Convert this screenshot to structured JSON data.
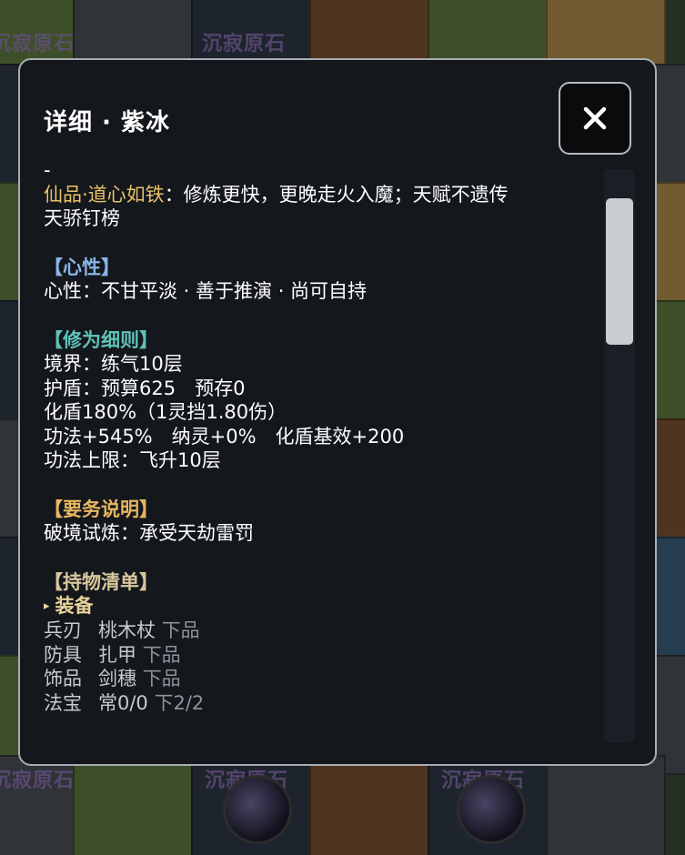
{
  "background": {
    "shrine_label": "沉寂原石"
  },
  "dialog": {
    "title": "详细 · 紫冰",
    "close_icon": "close-icon"
  },
  "content": {
    "dash": "-",
    "trait_name": "仙品·道心如铁",
    "trait_desc": "：修炼更快，更晚走火入魔；天赋不遗传",
    "title_line": "天骄钉榜",
    "mind": {
      "header": "【心性】",
      "line": "心性：不甘平淡 · 善于推演 · 尚可自持"
    },
    "cultivation": {
      "header": "【修为细则】",
      "lines": [
        "境界：练气10层",
        "护盾：预算625　预存0",
        "化盾180%（1灵挡1.80伤）",
        "功法+545%　纳灵+0%　化盾基效+200",
        "功法上限：飞升10层"
      ]
    },
    "duty": {
      "header": "【要务说明】",
      "line": "破境试炼：承受天劫雷罚"
    },
    "inventory": {
      "header": "【持物清单】",
      "sub_header": "装备",
      "items": [
        {
          "slot": "兵刃",
          "name": "桃木杖",
          "grade": "下品"
        },
        {
          "slot": "防具",
          "name": "扎甲",
          "grade": "下品"
        },
        {
          "slot": "饰品",
          "name": "剑穗",
          "grade": "下品"
        },
        {
          "slot": "法宝",
          "name": "常0/0",
          "grade": "下2/2"
        }
      ]
    }
  },
  "colors": {
    "panel_bg": "#14171c",
    "gold": "#e8c267",
    "teal": "#5fc2b8",
    "blue": "#8ab4e6"
  }
}
